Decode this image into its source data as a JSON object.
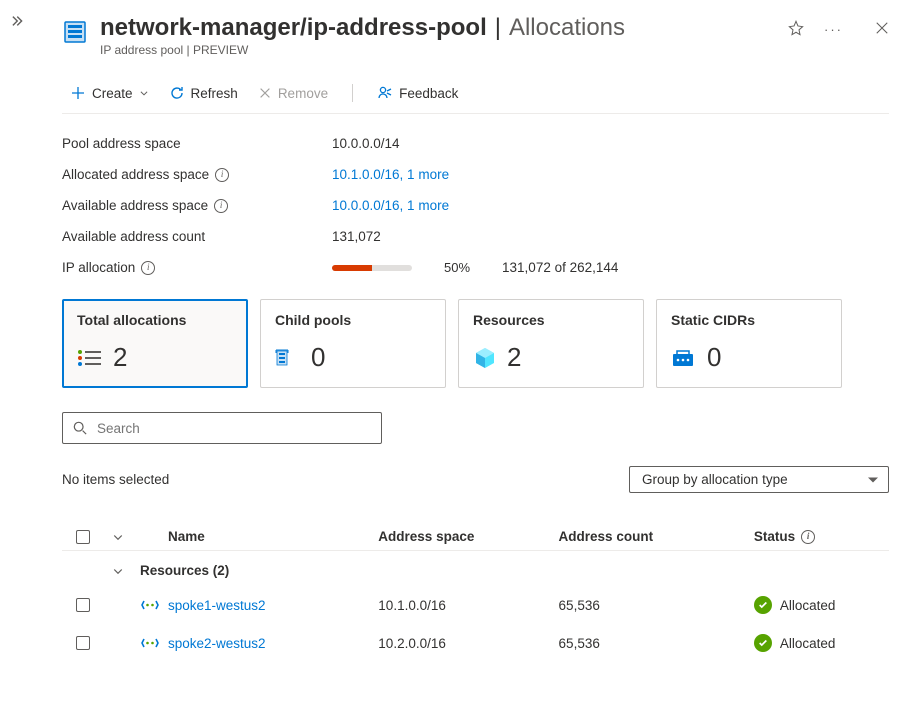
{
  "header": {
    "resource_name": "network-manager/ip-address-pool",
    "section": "Allocations",
    "subtitle": "IP address pool | PREVIEW"
  },
  "toolbar": {
    "create": "Create",
    "refresh": "Refresh",
    "remove": "Remove",
    "feedback": "Feedback"
  },
  "properties": {
    "pool_addr_space_label": "Pool address space",
    "pool_addr_space": "10.0.0.0/14",
    "alloc_addr_space_label": "Allocated address space",
    "alloc_addr_space": "10.1.0.0/16, 1 more",
    "avail_addr_space_label": "Available address space",
    "avail_addr_space": "10.0.0.0/16, 1 more",
    "avail_addr_count_label": "Available address count",
    "avail_addr_count": "131,072",
    "ip_alloc_label": "IP allocation",
    "ip_alloc_pct": "50%",
    "ip_alloc_fill_pct": 50,
    "ip_alloc_counts": "131,072 of 262,144"
  },
  "cards": {
    "total": {
      "title": "Total allocations",
      "value": "2"
    },
    "child": {
      "title": "Child pools",
      "value": "0"
    },
    "resources": {
      "title": "Resources",
      "value": "2"
    },
    "static": {
      "title": "Static CIDRs",
      "value": "0"
    }
  },
  "search": {
    "placeholder": "Search"
  },
  "selection": {
    "no_items": "No items selected",
    "group_by_label": "Group by allocation type"
  },
  "table": {
    "headers": {
      "name": "Name",
      "address_space": "Address space",
      "address_count": "Address count",
      "status": "Status"
    },
    "group_label": "Resources (2)",
    "rows": [
      {
        "name": "spoke1-westus2",
        "address_space": "10.1.0.0/16",
        "address_count": "65,536",
        "status": "Allocated"
      },
      {
        "name": "spoke2-westus2",
        "address_space": "10.2.0.0/16",
        "address_count": "65,536",
        "status": "Allocated"
      }
    ]
  }
}
